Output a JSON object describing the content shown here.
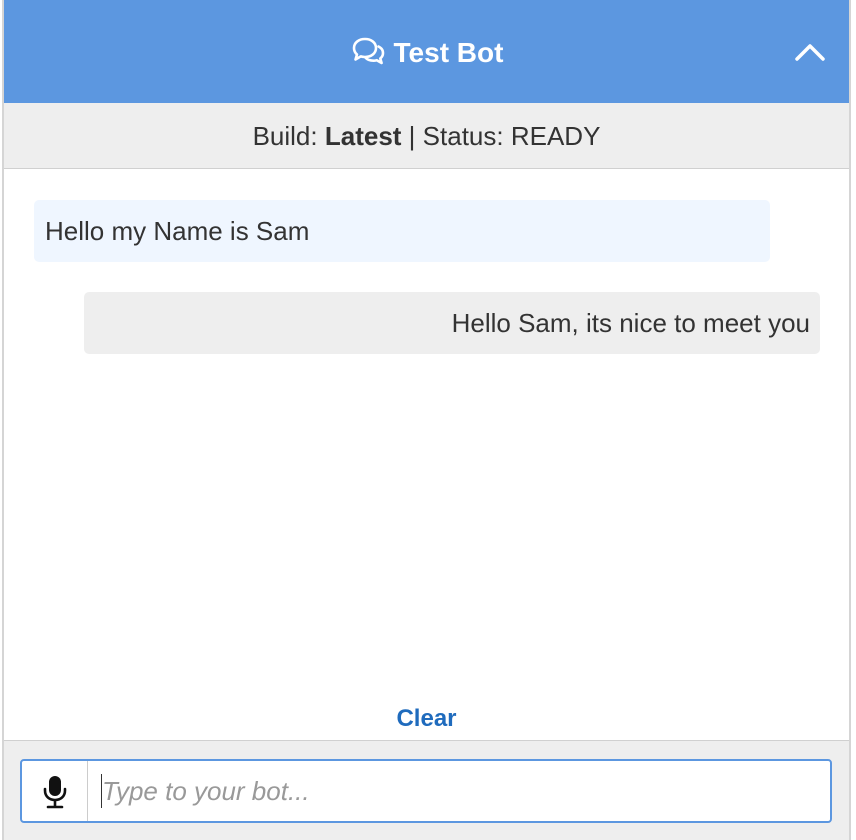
{
  "header": {
    "title": "Test Bot",
    "chat_icon": "chat-bubbles-icon",
    "collapse_icon": "chevron-up-icon",
    "background_color": "#5c97e0"
  },
  "status_bar": {
    "build_label": "Build:",
    "build_value": "Latest",
    "separator": "|",
    "status_label": "Status:",
    "status_value": "READY"
  },
  "messages": [
    {
      "sender": "user",
      "text": "Hello my Name is Sam",
      "bubble_color": "#eff6ff"
    },
    {
      "sender": "bot",
      "text": "Hello Sam, its nice to meet you",
      "bubble_color": "#eeeeee"
    }
  ],
  "clear_label": "Clear",
  "input": {
    "placeholder": "Type to your bot...",
    "value": "",
    "mic_icon": "microphone-icon"
  }
}
